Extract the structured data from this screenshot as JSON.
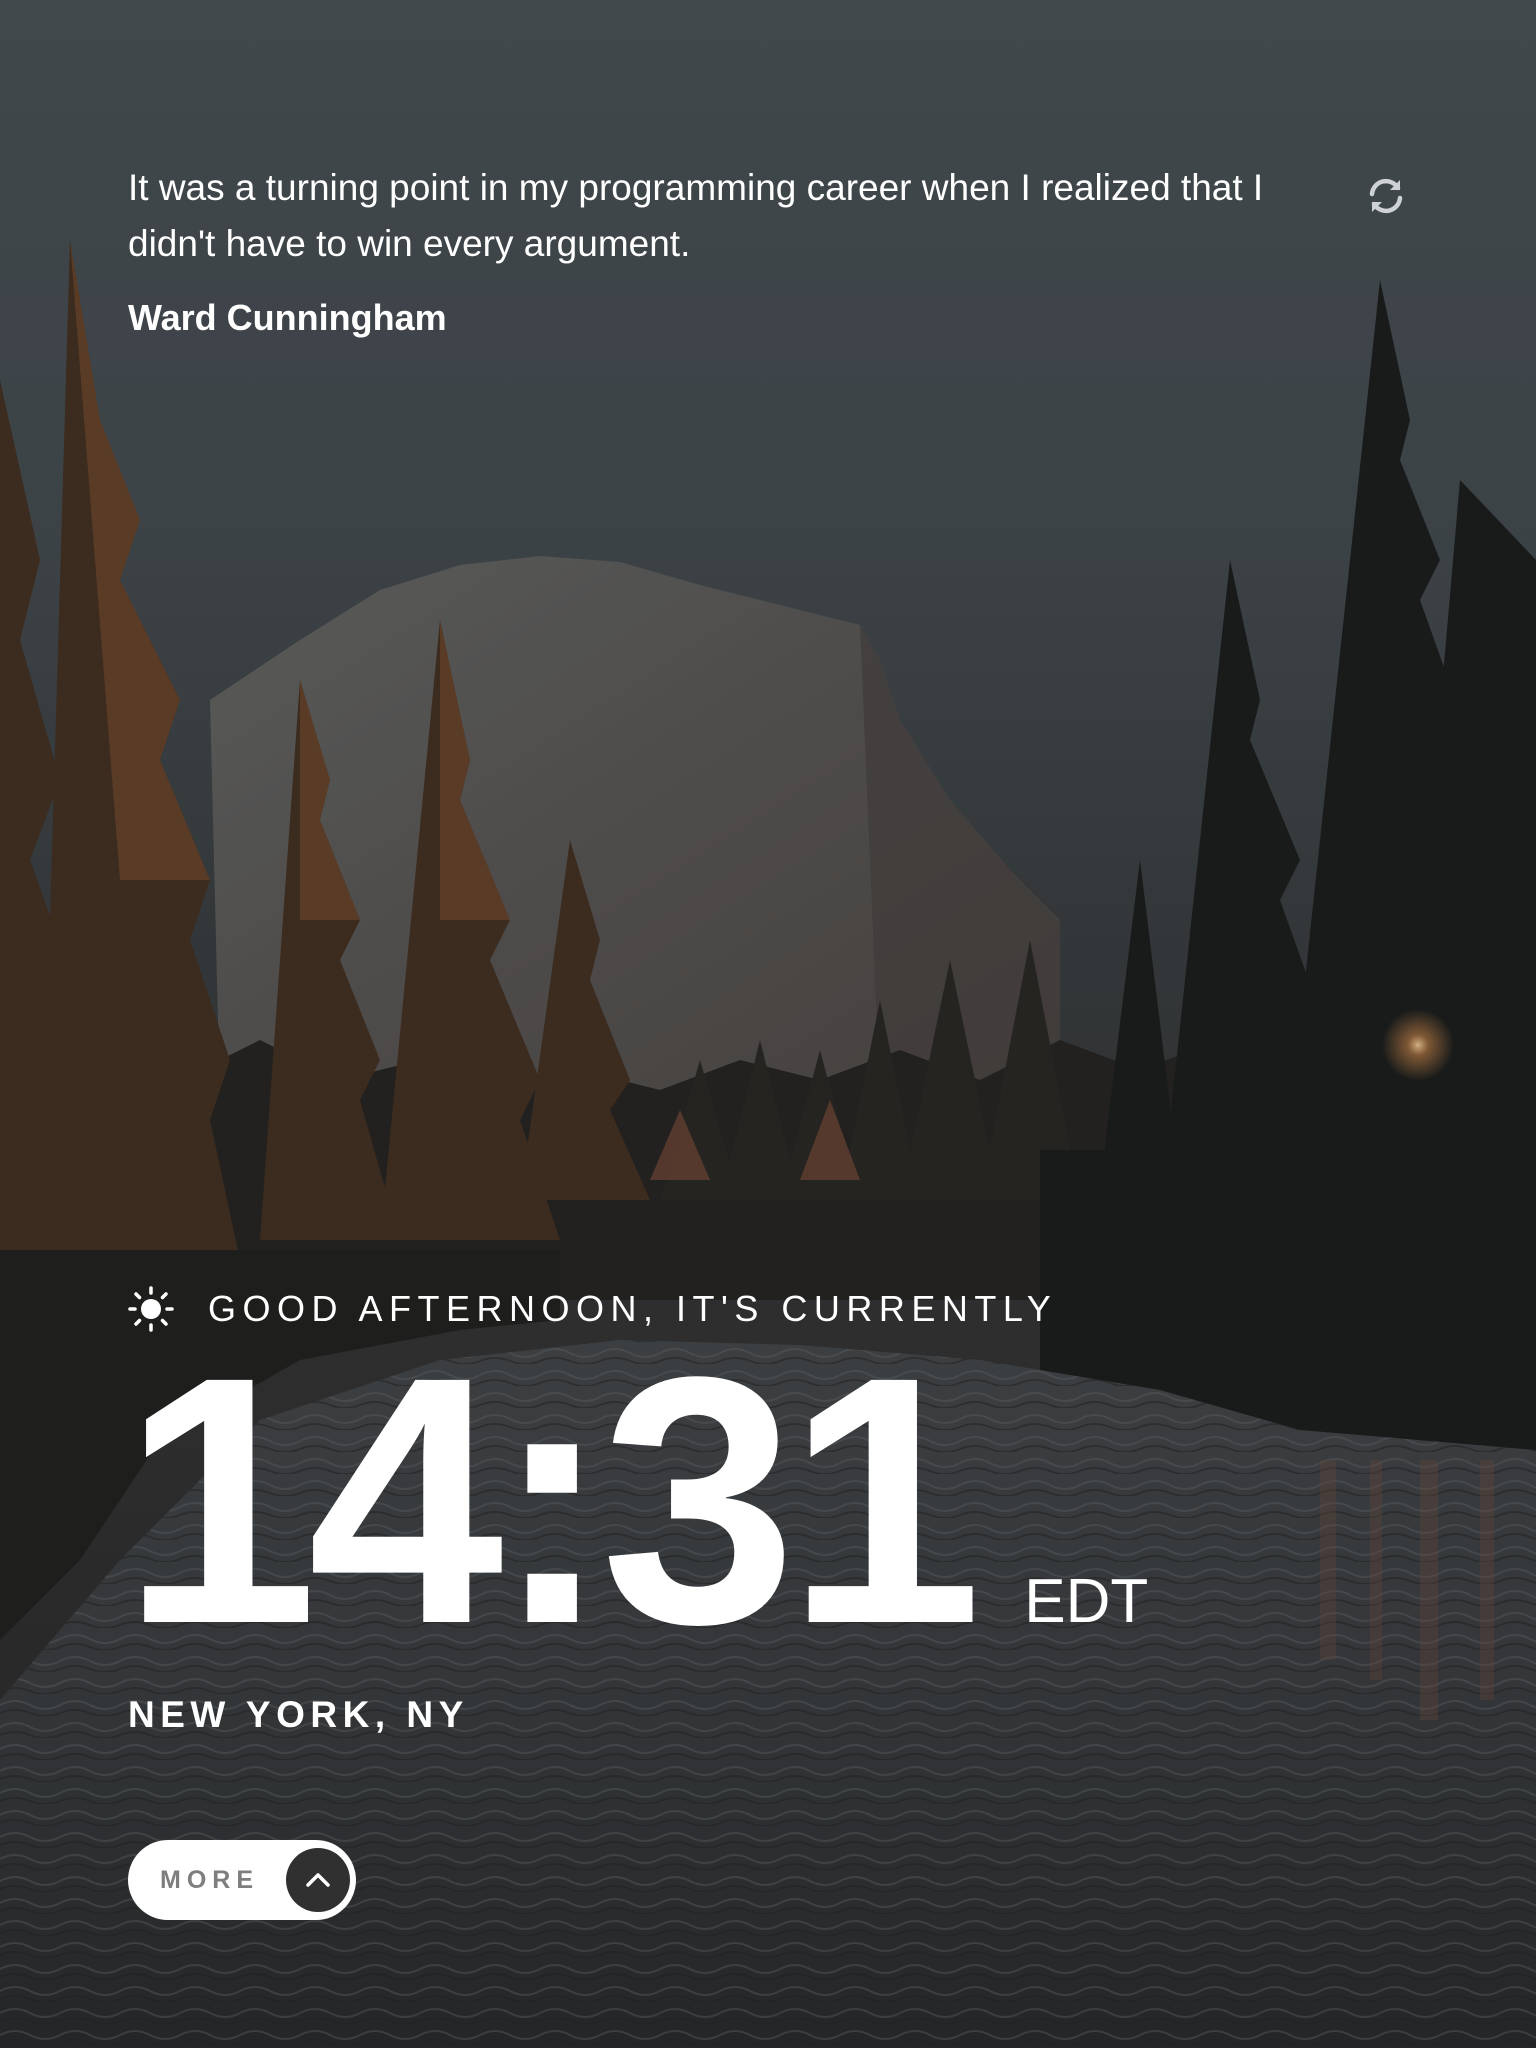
{
  "quote": {
    "text": "It was a turning point in my programming career when I realized that I didn't have to win every argument.",
    "author": "Ward Cunningham",
    "refresh_icon": "refresh-icon"
  },
  "clock": {
    "greeting": "GOOD AFTERNOON, IT'S CURRENTLY",
    "greeting_icon": "sun-icon",
    "time": "14:31",
    "timezone": "EDT",
    "location": "NEW YORK, NY"
  },
  "more_button": {
    "label": "MORE",
    "icon": "chevron-up-icon"
  },
  "colors": {
    "text": "#ffffff",
    "button_bg": "#ffffff",
    "button_label": "#7e7e7e",
    "chevron_bg": "#303030"
  }
}
